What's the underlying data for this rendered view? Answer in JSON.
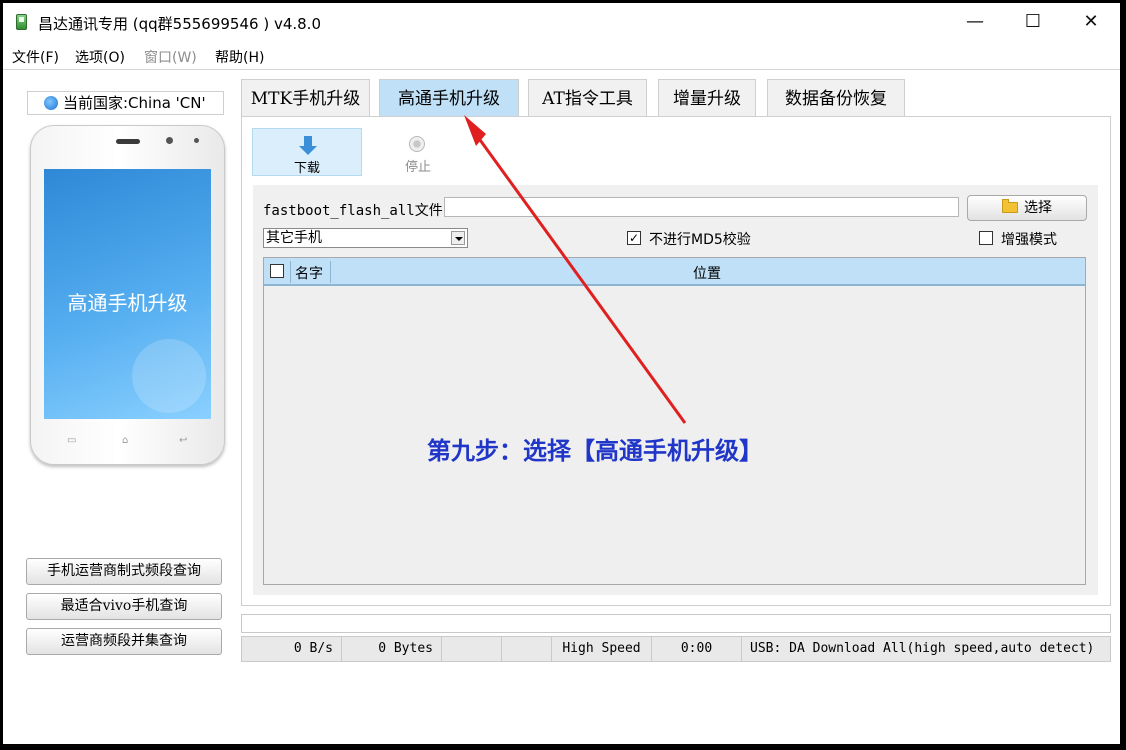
{
  "window": {
    "title": "昌达通讯专用    (qq群555699546 )  v4.8.0",
    "minimize": "—",
    "maximize": "☐",
    "close": "✕"
  },
  "menu": [
    "文件(F)",
    "选项(O)",
    "窗口(W)",
    "帮助(H)"
  ],
  "left": {
    "country": "当前国家:China 'CN'",
    "phone_screen_text": "高通手机升级",
    "phone_keys": [
      "▭",
      "⌂",
      "↩"
    ],
    "buttons": [
      "手机运营商制式频段查询",
      "最适合vivo手机查询",
      "运营商频段并集查询"
    ]
  },
  "tabs": [
    {
      "label": "MTK手机升级",
      "active": false
    },
    {
      "label": "高通手机升级",
      "active": true
    },
    {
      "label": "AT指令工具",
      "active": false
    },
    {
      "label": "增量升级",
      "active": false
    },
    {
      "label": "数据备份恢复",
      "active": false
    }
  ],
  "toolbar": {
    "download": "下载",
    "stop": "停止"
  },
  "form": {
    "fastboot_label": "fastboot_flash_all文件",
    "fastboot_value": "",
    "select_button": "选择",
    "phone_type": "其它手机",
    "md5_checkbox_label": "不进行MD5校验",
    "md5_checked": true,
    "md5_check_glyph": "✓",
    "enhanced_mode_label": "增强模式",
    "enhanced_checked": false
  },
  "table": {
    "columns": [
      "名字",
      "位置"
    ],
    "rows": []
  },
  "annotation": "第九步：选择【高通手机升级】",
  "colors": {
    "annotation_text": "#2036c8",
    "arrow": "#e02020",
    "active_tab": "#bfe0f7"
  },
  "status": {
    "speed": "0 B/s",
    "bytes": "0 Bytes",
    "blank1": "",
    "blank2": "",
    "mode": "High Speed",
    "time": "0:00",
    "usb": "USB: DA Download All(high speed,auto detect)"
  }
}
